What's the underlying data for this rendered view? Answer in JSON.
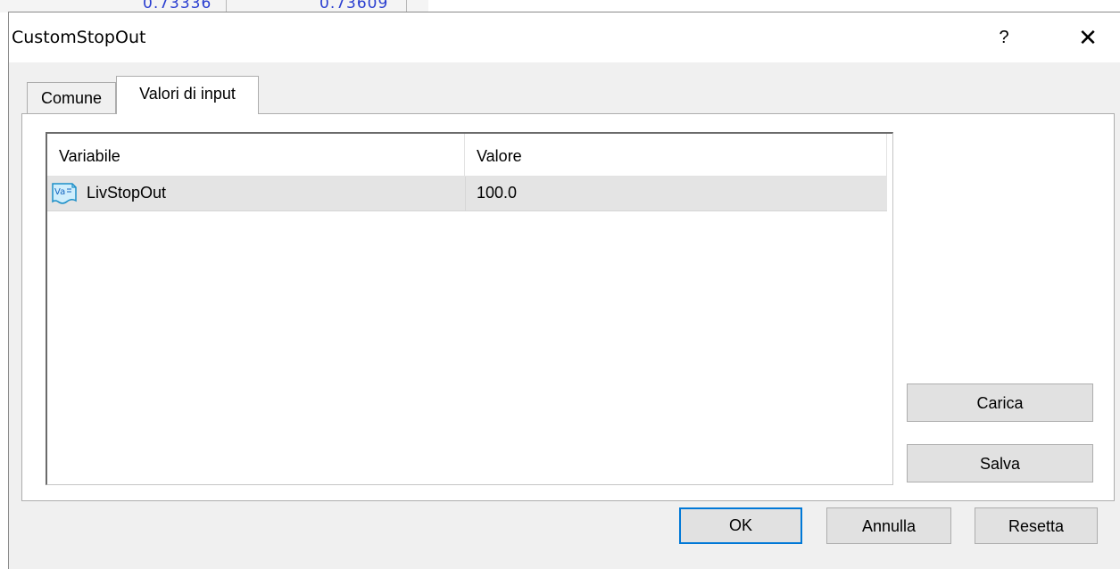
{
  "window": {
    "title": "CustomStopOut"
  },
  "titlebar": {
    "help_label": "?",
    "close_label": "✕"
  },
  "tabs": [
    {
      "label": "Comune",
      "active": false
    },
    {
      "label": "Valori di input",
      "active": true
    }
  ],
  "table": {
    "columns": [
      "Variabile",
      "Valore"
    ],
    "rows": [
      {
        "icon": "variable-icon",
        "variable": "LivStopOut",
        "value": "100.0"
      }
    ]
  },
  "side_buttons": {
    "load_label": "Carica",
    "save_label": "Salva"
  },
  "footer_buttons": {
    "ok_label": "OK",
    "cancel_label": "Annulla",
    "reset_label": "Resetta"
  },
  "background": {
    "values": [
      "0.73336",
      "0.73609"
    ]
  },
  "colors": {
    "accent": "#0078d7",
    "background_text": "#2a3ed0"
  }
}
